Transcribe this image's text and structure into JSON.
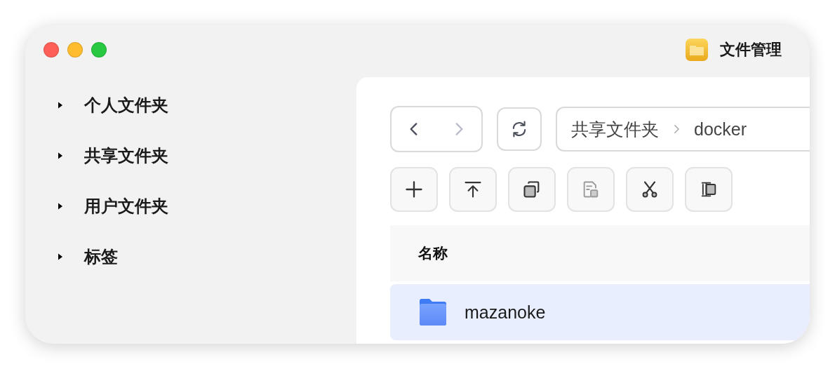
{
  "window": {
    "title": "文件管理"
  },
  "sidebar": {
    "items": [
      {
        "label": "个人文件夹",
        "expanded": false
      },
      {
        "label": "共享文件夹",
        "expanded": false
      },
      {
        "label": "用户文件夹",
        "expanded": false
      },
      {
        "label": "标签",
        "expanded": false
      }
    ]
  },
  "navigation": [
    {
      "kind": "back",
      "disabled": false
    },
    {
      "kind": "forward",
      "disabled": true
    }
  ],
  "breadcrumb": [
    "共享文件夹",
    "docker"
  ],
  "toolbar": [
    {
      "kind": "new",
      "disabled": false
    },
    {
      "kind": "upload",
      "disabled": false
    },
    {
      "kind": "copy",
      "disabled": false
    },
    {
      "kind": "paste",
      "disabled": true
    },
    {
      "kind": "cut",
      "disabled": false
    },
    {
      "kind": "rename",
      "disabled": false
    }
  ],
  "table": {
    "columns": [
      "名称"
    ],
    "rows": [
      {
        "name": "mazanoke",
        "selected": true
      }
    ]
  }
}
